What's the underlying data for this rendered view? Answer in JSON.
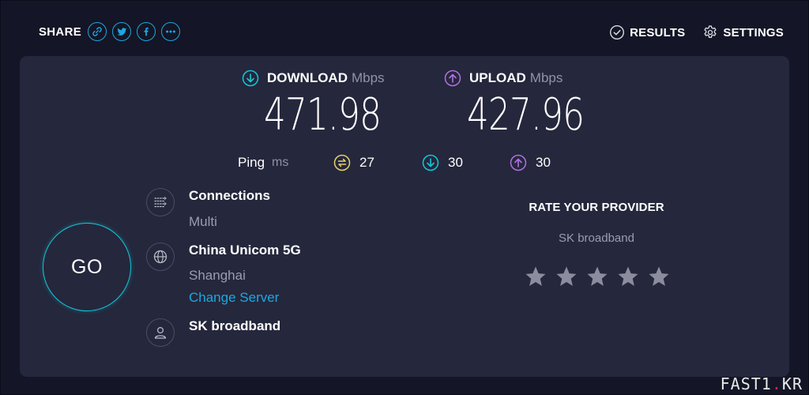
{
  "header": {
    "share_label": "SHARE",
    "share_buttons": [
      "link-icon",
      "twitter-icon",
      "facebook-icon",
      "more-icon"
    ],
    "results_label": "RESULTS",
    "settings_label": "SETTINGS"
  },
  "download": {
    "label": "DOWNLOAD",
    "unit": "Mbps",
    "value": "471.98"
  },
  "upload": {
    "label": "UPLOAD",
    "unit": "Mbps",
    "value": "427.96"
  },
  "ping": {
    "label": "Ping",
    "unit": "ms",
    "idle": "27",
    "download": "30",
    "upload": "30"
  },
  "go_label": "GO",
  "connections": {
    "title": "Connections",
    "value": "Multi"
  },
  "server": {
    "name": "China Unicom 5G",
    "location": "Shanghai",
    "change_label": "Change Server"
  },
  "provider": {
    "name": "SK broadband"
  },
  "rate": {
    "title": "RATE YOUR PROVIDER",
    "provider": "SK broadband",
    "stars": 5,
    "rating": 0
  },
  "watermark": {
    "left": "FAST1",
    "dot": ".",
    "right": "KR"
  },
  "colors": {
    "background": "#141526",
    "card": "#25273c",
    "accent_cyan": "#12c8d8",
    "link_blue": "#1ca8e0",
    "upload_purple": "#b071e0",
    "ping_yellow": "#e6d36a"
  }
}
